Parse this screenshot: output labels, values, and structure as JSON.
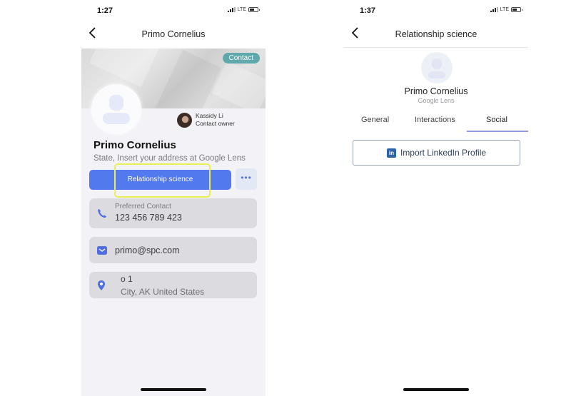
{
  "left_screen": {
    "status": {
      "time": "1:27",
      "network": "LTE"
    },
    "nav": {
      "title": "Primo Cornelius"
    },
    "badge": "Contact",
    "owner": {
      "name": "Kassidy Li",
      "role": "Contact owner"
    },
    "profile": {
      "name": "Primo Cornelius",
      "address": "State, Insert your address at Google Lens"
    },
    "actions": {
      "primary_label": "Relationship science",
      "more_label": "•••"
    },
    "highlight_color": "#e9ef55",
    "accent_color": "#5379ee",
    "cards": {
      "phone": {
        "label": "Preferred Contact",
        "value": "123 456 789 423"
      },
      "email": {
        "value": "primo@spc.com"
      },
      "address": {
        "line1": "o 1",
        "line2": "City, AK  United States"
      }
    }
  },
  "right_screen": {
    "status": {
      "time": "1:37",
      "network": "LTE"
    },
    "nav": {
      "title": "Relationship science"
    },
    "profile": {
      "name": "Primo Cornelius",
      "subtitle": "Google Lens"
    },
    "tabs": [
      {
        "label": "General",
        "active": false
      },
      {
        "label": "Interactions",
        "active": false
      },
      {
        "label": "Social",
        "active": true
      }
    ],
    "linkedin": {
      "icon_text": "in",
      "label": "Import LinkedIn Profile"
    }
  }
}
